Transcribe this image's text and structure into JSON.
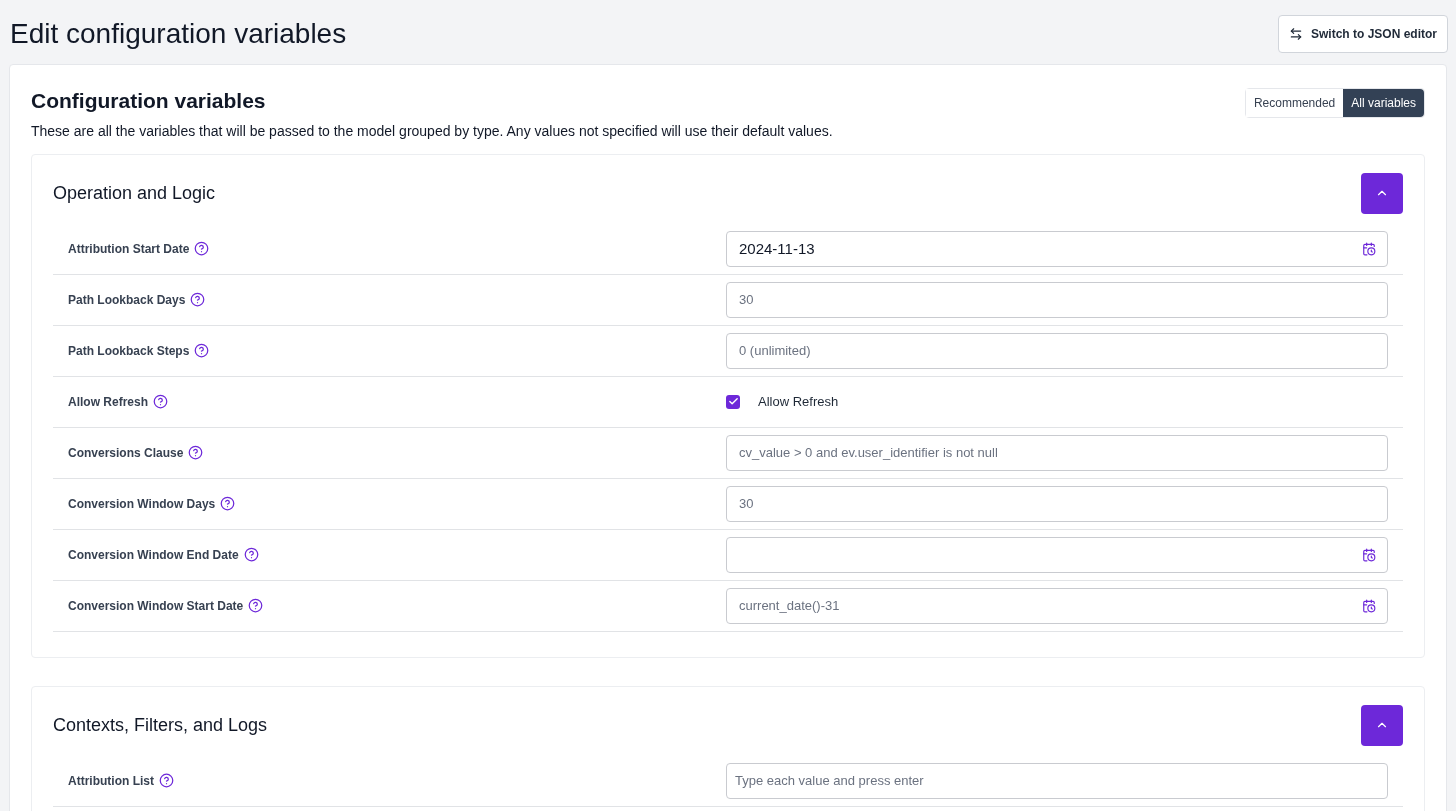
{
  "page": {
    "title": "Edit configuration variables",
    "switch_button": "Switch to JSON editor"
  },
  "card": {
    "title": "Configuration variables",
    "description": "These are all the variables that will be passed to the model grouped by type. Any values not specified will use their default values.",
    "view_toggle": [
      {
        "label": "Recommended",
        "selected": false
      },
      {
        "label": "All variables",
        "selected": true
      }
    ]
  },
  "sections": [
    {
      "title": "Operation and Logic",
      "expanded": true,
      "rows": [
        {
          "label": "Attribution Start Date",
          "kind": "date",
          "value": "2024-11-13"
        },
        {
          "label": "Path Lookback Days",
          "kind": "text",
          "placeholder": "30"
        },
        {
          "label": "Path Lookback Steps",
          "kind": "text",
          "placeholder": "0 (unlimited)"
        },
        {
          "label": "Allow Refresh",
          "kind": "checkbox",
          "checked": true,
          "caption": "Allow Refresh"
        },
        {
          "label": "Conversions Clause",
          "kind": "text",
          "placeholder": "cv_value > 0 and ev.user_identifier is not null"
        },
        {
          "label": "Conversion Window Days",
          "kind": "text",
          "placeholder": "30"
        },
        {
          "label": "Conversion Window End Date",
          "kind": "date"
        },
        {
          "label": "Conversion Window Start Date",
          "kind": "date",
          "placeholder": "current_date()-31"
        }
      ]
    },
    {
      "title": "Contexts, Filters, and Logs",
      "expanded": true,
      "rows": [
        {
          "label": "Attribution List",
          "kind": "tags",
          "placeholder": "Type each value and press enter"
        }
      ]
    }
  ]
}
